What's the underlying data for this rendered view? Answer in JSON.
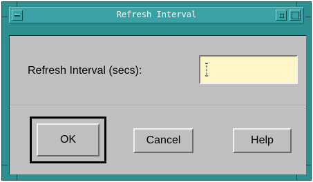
{
  "window": {
    "title": "Refresh Interval"
  },
  "form": {
    "label": "Refresh Interval (secs):",
    "value": ""
  },
  "buttons": {
    "ok": "OK",
    "cancel": "Cancel",
    "help": "Help"
  },
  "colors": {
    "frame": "#2e8f91",
    "titlebar": "#3aa2a4",
    "panel": "#c0c0c0",
    "input_bg": "#fff6c8"
  }
}
